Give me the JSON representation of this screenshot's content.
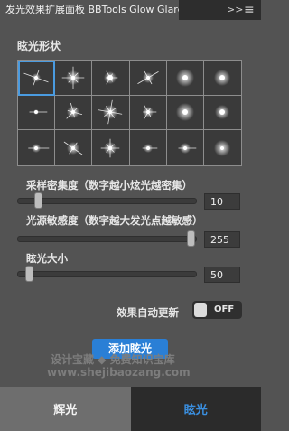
{
  "window": {
    "tab_title": "发光效果扩展面板 BBTools Glow Glare",
    "collapse_icon": "double-chevron-right",
    "menu_icon": "hamburger-menu"
  },
  "shapes": {
    "title": "眩光形状",
    "count": 18,
    "selected_index": 0
  },
  "sliders": [
    {
      "label": "采样密集度（数字越小炫光越密集）",
      "value": "10",
      "fraction": 0.1
    },
    {
      "label": "光源敏感度（数字越大发光点越敏感）",
      "value": "255",
      "fraction": 1.0
    },
    {
      "label": "眩光大小",
      "value": "50",
      "fraction": 0.05
    }
  ],
  "auto_update": {
    "label": "效果自动更新",
    "state": "OFF"
  },
  "add_button": "添加眩光",
  "watermark": {
    "line1": "设计宝藏 ◆ 免费知识宝库",
    "line2": "www.shejibaozang.com"
  },
  "bottom_tabs": {
    "glow": "辉光",
    "glare": "眩光",
    "active": "glare"
  },
  "colors": {
    "panel_bg": "#535353",
    "accent": "#2a7fd6",
    "active_tab_text": "#3a8fe0"
  }
}
